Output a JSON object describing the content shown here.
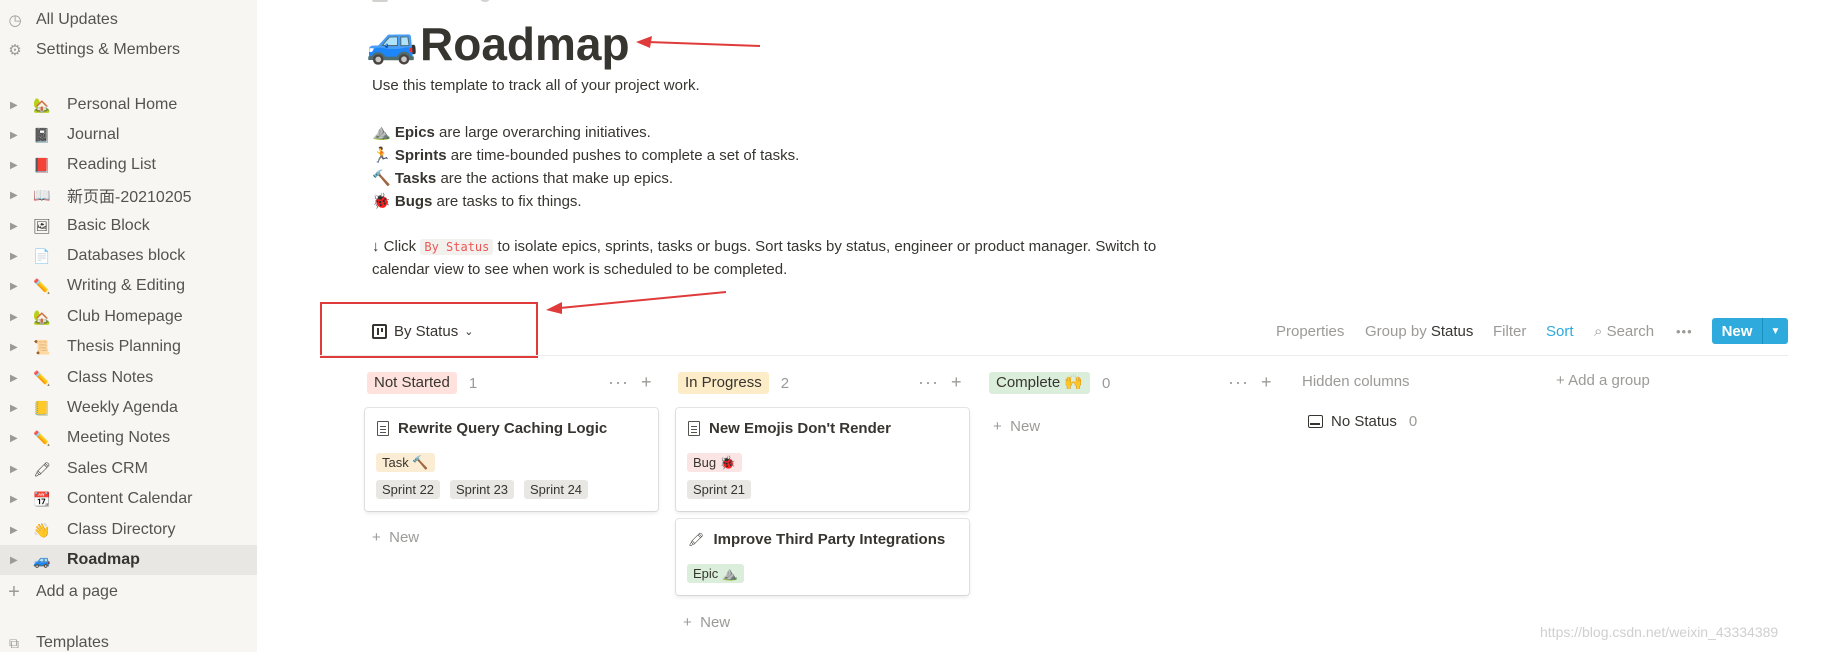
{
  "sidebar": {
    "top": [
      {
        "icon": "clock-icon",
        "glyph": "◷",
        "label": "All Updates"
      },
      {
        "icon": "gear-icon",
        "glyph": "⚙",
        "label": "Settings & Members"
      }
    ],
    "pages": [
      {
        "emoji": "🏡",
        "label": "Personal Home"
      },
      {
        "emoji": "📓",
        "label": "Journal"
      },
      {
        "emoji": "📕",
        "label": "Reading List"
      },
      {
        "emoji": "📖",
        "label": "新页面-20210205"
      },
      {
        "emoji": "🖼",
        "label": "Basic Block"
      },
      {
        "emoji": "📄",
        "label": "Databases block"
      },
      {
        "emoji": "✏️",
        "label": "Writing & Editing"
      },
      {
        "emoji": "🏡",
        "label": "Club Homepage"
      },
      {
        "emoji": "📜",
        "label": "Thesis Planning"
      },
      {
        "emoji": "✏️",
        "label": "Class Notes"
      },
      {
        "emoji": "📒",
        "label": "Weekly Agenda"
      },
      {
        "emoji": "✏️",
        "label": "Meeting Notes"
      },
      {
        "emoji": "🖍",
        "label": "Sales CRM"
      },
      {
        "emoji": "📆",
        "label": "Content Calendar"
      },
      {
        "emoji": "👋",
        "label": "Class Directory"
      },
      {
        "emoji": "🚙",
        "label": "Roadmap"
      }
    ],
    "add_page": "Add a page",
    "templates": "Templates"
  },
  "page": {
    "icon": "🚙",
    "title": "Roadmap",
    "intro": "Use this template to track all of your project work.",
    "lines": [
      {
        "emoji": "⛰️",
        "bold": "Epics",
        "rest": " are large overarching initiatives."
      },
      {
        "emoji": "🏃",
        "bold": "Sprints",
        "rest": " are time-bounded pushes to complete a set of tasks."
      },
      {
        "emoji": "🔨",
        "bold": "Tasks",
        "rest": " are the actions that make up epics."
      },
      {
        "emoji": "🐞",
        "bold": "Bugs",
        "rest": " are tasks to fix things."
      }
    ],
    "click_prefix": "↓ Click ",
    "click_code": "By Status",
    "click_rest": " to isolate epics, sprints, tasks or bugs. Sort tasks by status, engineer or product manager. Switch to",
    "click_line2": "calendar view to see when work is scheduled to be completed."
  },
  "view": {
    "label": "By Status",
    "chevron": "⌄"
  },
  "toolbar": {
    "properties": "Properties",
    "group_by": "Group by",
    "group_value": "Status",
    "filter": "Filter",
    "sort": "Sort",
    "search": "Search",
    "more": "•••",
    "new": "New"
  },
  "columns": [
    {
      "name": "Not Started",
      "count": "1",
      "color": "#ffe2dd"
    },
    {
      "name": "In Progress",
      "count": "2",
      "color": "#fdecc8"
    },
    {
      "name": "Complete 🙌",
      "count": "0",
      "color": "#dbeddb"
    }
  ],
  "cards": {
    "c1": {
      "title": "Rewrite Query Caching Logic",
      "tag": "Task 🔨",
      "sprints": [
        "Sprint 22",
        "Sprint 23",
        "Sprint 24"
      ]
    },
    "c2": {
      "title": "New Emojis Don't Render",
      "tag": "Bug 🐞",
      "sprints": [
        "Sprint 21"
      ]
    },
    "c3": {
      "emoji": "🖍",
      "title": "Improve Third Party Integrations",
      "tag": "Epic ⛰️"
    }
  },
  "new_label": "New",
  "hidden_columns": "Hidden columns",
  "no_status": {
    "label": "No Status",
    "count": "0"
  },
  "add_group": "Add a group",
  "watermark": "https://blog.csdn.net/weixin_43334389"
}
